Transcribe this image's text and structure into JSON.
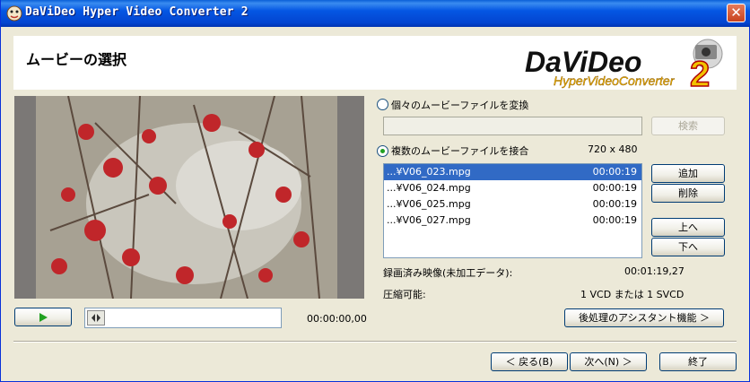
{
  "window": {
    "title": "DaViDeo Hyper Video Converter 2",
    "close_label": "✕"
  },
  "header": {
    "title": "ムービーの選択",
    "logo": {
      "text": "DaViDeo",
      "subtext": "HyperVideoConverter",
      "badge": "2"
    }
  },
  "player": {
    "time": "00:00:00,00"
  },
  "options": {
    "single_label": "個々のムービーファイルを変換",
    "single_selected": false,
    "merge_label": "複数のムービーファイルを接合",
    "merge_selected": true,
    "resolution": "720 x 480"
  },
  "buttons": {
    "browse": "検索",
    "add": "追加",
    "delete": "削除",
    "up": "上へ",
    "down": "下へ",
    "post": "後処理のアシスタント機能 ＞",
    "back": "＜ 戻る(B)",
    "next": "次へ(N) ＞",
    "finish": "終了"
  },
  "files": [
    {
      "name": "...¥V06_023.mpg",
      "duration": "00:00:19",
      "selected": true
    },
    {
      "name": "...¥V06_024.mpg",
      "duration": "00:00:19",
      "selected": false
    },
    {
      "name": "...¥V06_025.mpg",
      "duration": "00:00:19",
      "selected": false
    },
    {
      "name": "...¥V06_027.mpg",
      "duration": "00:00:19",
      "selected": false
    }
  ],
  "info": {
    "recorded_label": "録画済み映像(未加工データ):",
    "recorded_value": "00:01:19,27",
    "compress_label": "圧縮可能:",
    "compress_value": "1 VCD または 1 SVCD"
  },
  "colors": {
    "titlebar": "#0456e3",
    "selection": "#316ac5",
    "dialog": "#ece9d8",
    "radio_dot": "#21a121"
  }
}
